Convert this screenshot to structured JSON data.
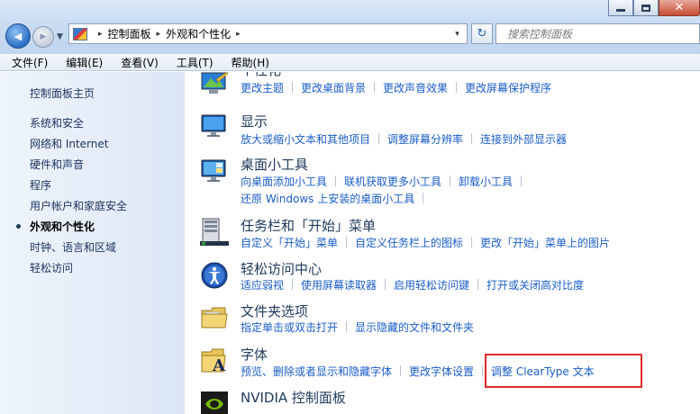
{
  "window": {
    "minimize_icon": "minimize-icon",
    "maximize_icon": "maximize-icon",
    "close_symbol": "✕"
  },
  "navigation": {
    "back_symbol": "◀",
    "forward_symbol": "▶"
  },
  "address": {
    "crumbs": [
      "控制面板",
      "外观和个性化"
    ],
    "separator": "▸",
    "dropdown": "▾",
    "refresh": "↻"
  },
  "search": {
    "placeholder": "搜索控制面板"
  },
  "menu": {
    "items": [
      "文件(F)",
      "编辑(E)",
      "查看(V)",
      "工具(T)",
      "帮助(H)"
    ]
  },
  "sidebar": {
    "home": "控制面板主页",
    "items": [
      "系统和安全",
      "网络和 Internet",
      "硬件和声音",
      "程序",
      "用户帐户和家庭安全",
      "外观和个性化",
      "时钟、语言和区域",
      "轻松访问"
    ],
    "active_index": 5
  },
  "categories": [
    {
      "title": "个性化",
      "icon": "personalization-icon",
      "links": [
        [
          "更改主题",
          "更改桌面背景",
          "更改声音效果",
          "更改屏幕保护程序"
        ]
      ]
    },
    {
      "title": "显示",
      "icon": "display-icon",
      "links": [
        [
          "放大或缩小文本和其他项目",
          "调整屏幕分辨率",
          "连接到外部显示器"
        ]
      ]
    },
    {
      "title": "桌面小工具",
      "icon": "gadgets-icon",
      "links": [
        [
          "向桌面添加小工具",
          "联机获取更多小工具",
          "卸载小工具"
        ],
        [
          "还原 Windows 上安装的桌面小工具"
        ]
      ]
    },
    {
      "title": "任务栏和「开始」菜单",
      "icon": "taskbar-icon",
      "links": [
        [
          "自定义「开始」菜单",
          "自定义任务栏上的图标",
          "更改「开始」菜单上的图片"
        ]
      ]
    },
    {
      "title": "轻松访问中心",
      "icon": "ease-of-access-icon",
      "links": [
        [
          "适应弱视",
          "使用屏幕读取器",
          "启用轻松访问键",
          "打开或关闭高对比度"
        ]
      ]
    },
    {
      "title": "文件夹选项",
      "icon": "folder-options-icon",
      "links": [
        [
          "指定单击或双击打开",
          "显示隐藏的文件和文件夹"
        ]
      ]
    },
    {
      "title": "字体",
      "icon": "fonts-icon",
      "links": [
        [
          "预览、删除或者显示和隐藏字体",
          "更改字体设置",
          "调整 ClearType 文本"
        ]
      ]
    },
    {
      "title": "NVIDIA 控制面板",
      "icon": "nvidia-icon",
      "links": []
    }
  ],
  "colors": {
    "link": "#1a5cc8",
    "title": "#1e395b",
    "highlight_box": "#e02a2a"
  }
}
